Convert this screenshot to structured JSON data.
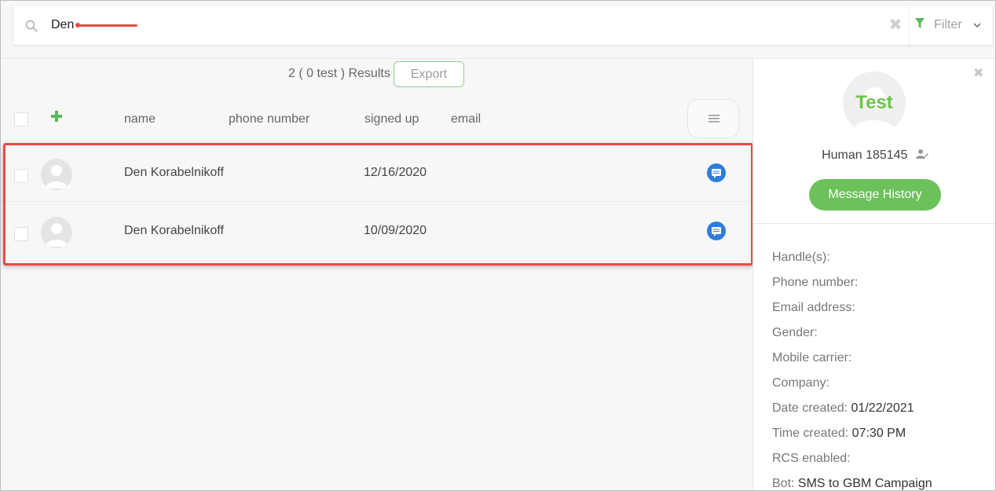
{
  "search": {
    "value": "Den",
    "placeholder": ""
  },
  "filter": {
    "label": "Filter"
  },
  "results": {
    "summary": "2 ( 0 test ) Results",
    "export_label": "Export"
  },
  "table": {
    "columns": [
      "name",
      "phone number",
      "signed up",
      "email"
    ],
    "rows": [
      {
        "name": "Den Korabelnikoff",
        "phone": "",
        "signed_up": "12/16/2020",
        "email": ""
      },
      {
        "name": "Den Korabelnikoff",
        "phone": "",
        "signed_up": "10/09/2020",
        "email": ""
      }
    ]
  },
  "profile": {
    "avatar_text": "Test",
    "display_name": "Human 185145",
    "message_history_label": "Message History",
    "fields": [
      {
        "label": "Handle(s):",
        "value": ""
      },
      {
        "label": "Phone number:",
        "value": ""
      },
      {
        "label": "Email address:",
        "value": ""
      },
      {
        "label": "Gender:",
        "value": ""
      },
      {
        "label": "Mobile carrier:",
        "value": ""
      },
      {
        "label": "Company:",
        "value": ""
      },
      {
        "label": "Date created:",
        "value": "01/22/2021"
      },
      {
        "label": "Time created:",
        "value": "07:30 PM"
      },
      {
        "label": "RCS enabled:",
        "value": ""
      },
      {
        "label": "Bot:",
        "value": "SMS to GBM Campaign"
      }
    ]
  },
  "colors": {
    "accent_green": "#6cc15a",
    "highlight_red": "#e84a4a",
    "chat_blue": "#2f7ddb"
  },
  "icons": [
    "search-icon",
    "clear-icon",
    "filter-icon",
    "chevron-down-icon",
    "plus-icon",
    "menu-icon",
    "user-avatar-icon",
    "chat-icon",
    "close-icon",
    "user-edit-icon"
  ]
}
